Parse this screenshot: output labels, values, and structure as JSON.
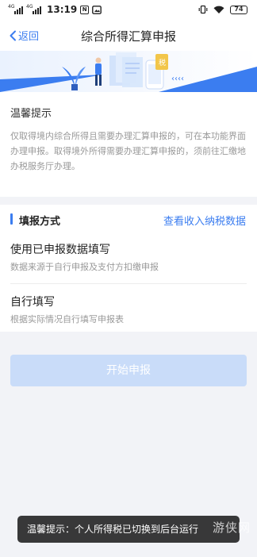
{
  "status_bar": {
    "sim1_net": "4G",
    "sim2_net": "4G",
    "time": "13:19",
    "nfc_badge": "N",
    "battery": "74",
    "icons": [
      "signal-icon",
      "nfc-icon",
      "vibrate-icon",
      "wifi-icon",
      "battery-icon"
    ]
  },
  "nav": {
    "back_label": "返回",
    "title": "综合所得汇算申报"
  },
  "notice": {
    "title": "温馨提示",
    "body": "仅取得境内综合所得且需要办理汇算申报的，可在本功能界面办理申报。取得境外所得需要办理汇算申报的，须前往汇缴地办税服务厅办理。"
  },
  "method": {
    "title": "填报方式",
    "link": "查看收入纳税数据",
    "options": [
      {
        "title": "使用已申报数据填写",
        "desc": "数据来源于自行申报及支付方扣缴申报"
      },
      {
        "title": "自行填写",
        "desc": "根据实际情况自行填写申报表"
      }
    ]
  },
  "start_button": {
    "label": "开始申报"
  },
  "toast": {
    "text": "温馨提示：个人所得税已切换到后台运行"
  },
  "watermark": "游侠网",
  "colors": {
    "accent": "#3b7df0",
    "disabled_button": "#c9dcf9",
    "background": "#f2f3f7"
  }
}
